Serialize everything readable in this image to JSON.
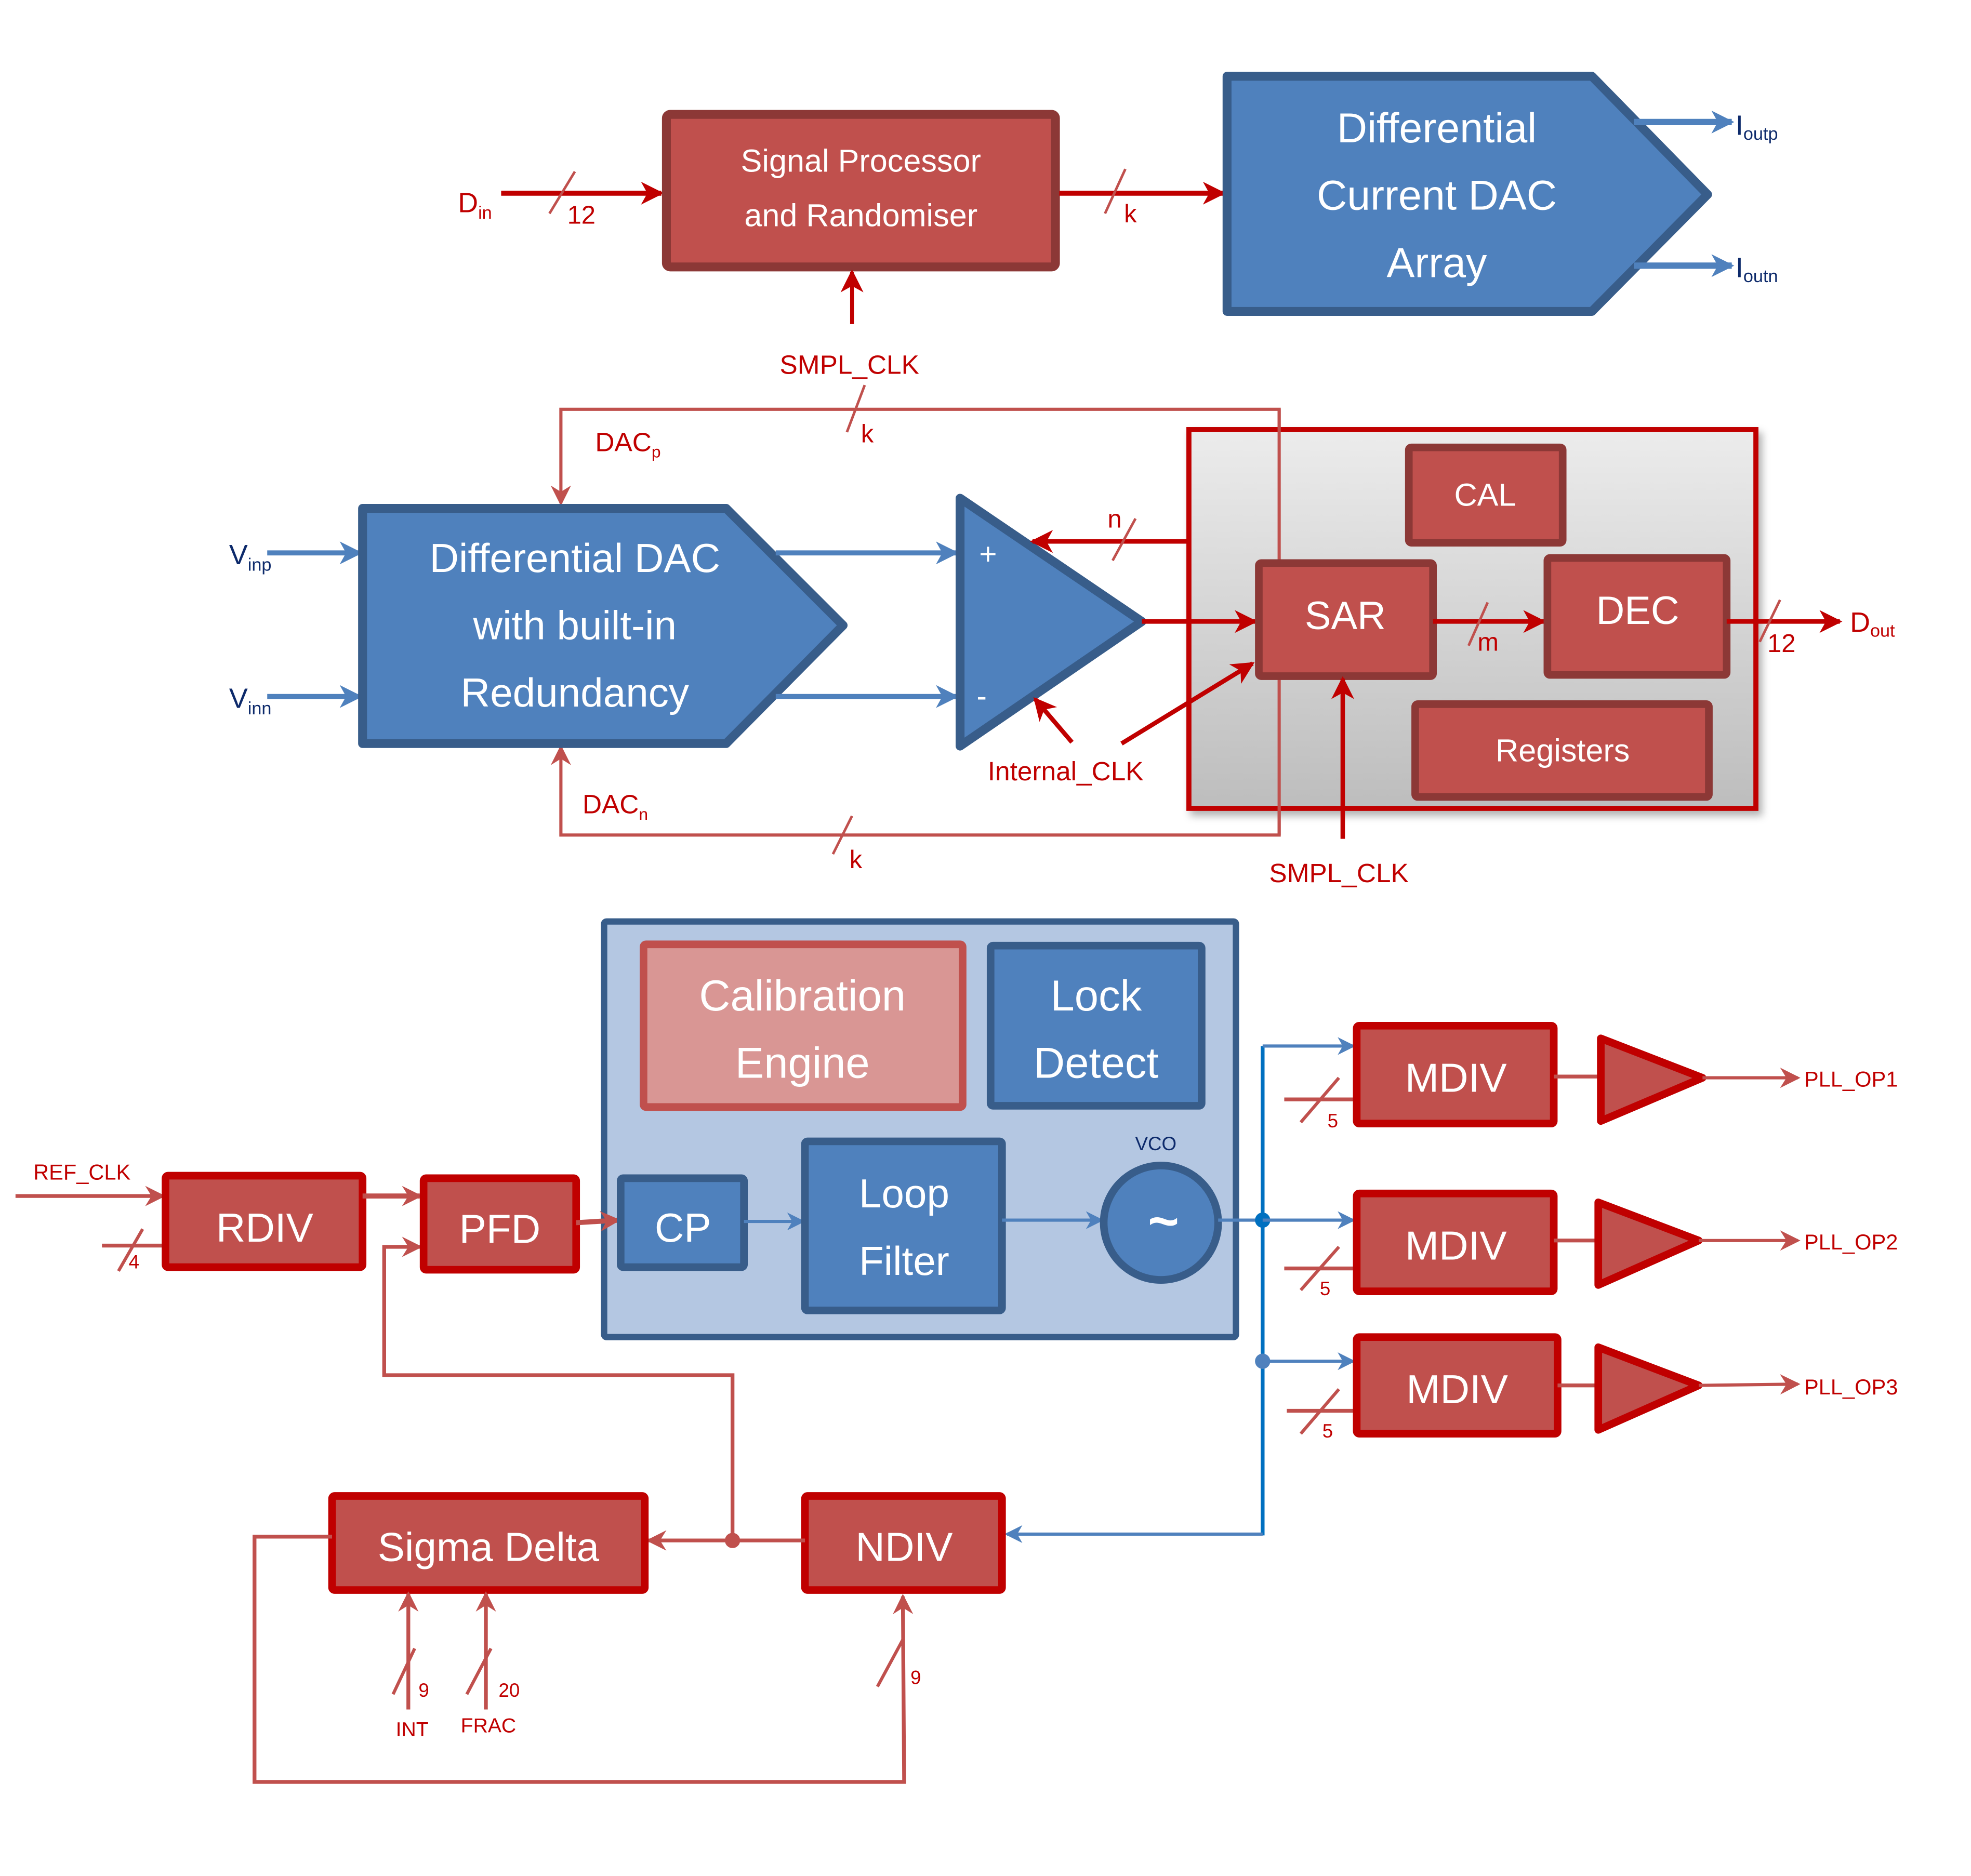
{
  "colors": {
    "red_fill": "#c0504d",
    "red_border_dark": "#8c3836",
    "red_bright": "#c00000",
    "light_red_fill": "#d99694",
    "blue_fill": "#4f81bd",
    "blue_border": "#385d8a",
    "light_blue_fill": "#b4c7e2",
    "navy_text": "#0d2a6b",
    "dot_blue": "#0070c0"
  },
  "dac_section": {
    "input_label": "D",
    "input_sub": "in",
    "input_bus_width": "12",
    "signal_processor": [
      "Signal Processor",
      "and Randomiser"
    ],
    "mid_bus_width": "k",
    "clock_label": "SMPL_CLK",
    "current_dac": [
      "Differential",
      "Current DAC",
      "Array"
    ],
    "outputs": [
      {
        "label": "I",
        "sub": "outp"
      },
      {
        "label": "I",
        "sub": "outn"
      }
    ]
  },
  "adc_section": {
    "inputs": [
      {
        "label": "V",
        "sub": "inp"
      },
      {
        "label": "V",
        "sub": "inn"
      }
    ],
    "dac_block": [
      "Differential DAC",
      "with built-in",
      "Redundancy"
    ],
    "dac_p": {
      "label": "DAC",
      "sub": "p"
    },
    "dac_n": {
      "label": "DAC",
      "sub": "n"
    },
    "feedback_bus_width_top": "k",
    "feedback_bus_width_bottom": "k",
    "comparator_plus": "+",
    "comparator_minus": "-",
    "offset_bus_width": "n",
    "internal_clk_label": "Internal_CLK",
    "sar": "SAR",
    "cal": "CAL",
    "dec": "DEC",
    "registers": "Registers",
    "sar_dec_bus_width": "m",
    "output_bus_width": "12",
    "output": {
      "label": "D",
      "sub": "out"
    },
    "clock_label": "SMPL_CLK"
  },
  "pll_section": {
    "ref_clk_label": "REF_CLK",
    "rdiv": "RDIV",
    "rdiv_bus_width": "4",
    "pfd": "PFD",
    "cp": "CP",
    "loop_filter": [
      "Loop",
      "Filter"
    ],
    "vco_label": "VCO",
    "vco_symbol": "~",
    "calibration_engine": [
      "Calibration",
      "Engine"
    ],
    "lock_detect": [
      "Lock",
      "Detect"
    ],
    "mdivs": [
      {
        "label": "MDIV",
        "bus_width": "5",
        "output": "PLL_OP1"
      },
      {
        "label": "MDIV",
        "bus_width": "5",
        "output": "PLL_OP2"
      },
      {
        "label": "MDIV",
        "bus_width": "5",
        "output": "PLL_OP3"
      }
    ],
    "ndiv": "NDIV",
    "ndiv_bus_width": "9",
    "sigma_delta": "Sigma Delta",
    "int_label": "INT",
    "int_bus_width": "9",
    "frac_label": "FRAC",
    "frac_bus_width": "20"
  }
}
